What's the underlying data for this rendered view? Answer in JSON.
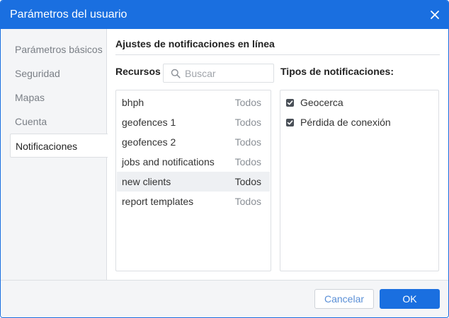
{
  "dialog": {
    "title": "Parámetros del usuario"
  },
  "sidebar": {
    "items": [
      {
        "label": "Parámetros básicos",
        "active": false
      },
      {
        "label": "Seguridad",
        "active": false
      },
      {
        "label": "Mapas",
        "active": false
      },
      {
        "label": "Cuenta",
        "active": false
      },
      {
        "label": "Notificaciones",
        "active": true
      }
    ]
  },
  "main": {
    "section_title": "Ajustes de notificaciones en línea",
    "resources_label": "Recursos",
    "search": {
      "placeholder": "Buscar",
      "value": ""
    },
    "types_label": "Tipos de notificaciones:",
    "resources": [
      {
        "name": "bhph",
        "access": "Todos",
        "highlighted": false
      },
      {
        "name": "geofences 1",
        "access": "Todos",
        "highlighted": false
      },
      {
        "name": "geofences 2",
        "access": "Todos",
        "highlighted": false
      },
      {
        "name": "jobs and notifications",
        "access": "Todos",
        "highlighted": false
      },
      {
        "name": "new clients",
        "access": "Todos",
        "highlighted": true
      },
      {
        "name": "report templates",
        "access": "Todos",
        "highlighted": false
      }
    ],
    "notification_types": [
      {
        "label": "Geocerca",
        "checked": true
      },
      {
        "label": "Pérdida de conexión",
        "checked": true
      }
    ]
  },
  "footer": {
    "cancel_label": "Cancelar",
    "ok_label": "OK"
  },
  "colors": {
    "accent": "#1a6fe0",
    "panel_bg": "#f4f5f7",
    "border": "#dcdfe3"
  }
}
